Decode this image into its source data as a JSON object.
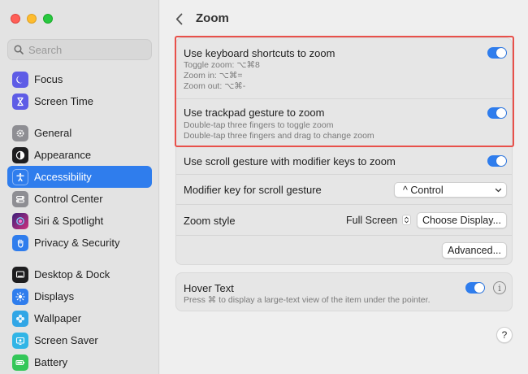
{
  "window": {
    "traffic_lights": [
      "close",
      "minimize",
      "maximize"
    ]
  },
  "sidebar": {
    "search": {
      "placeholder": "Search",
      "icon": "magnifying-glass-icon"
    },
    "items": [
      {
        "label": "Focus",
        "icon": "moon-icon",
        "color": "#5e5ce6"
      },
      {
        "label": "Screen Time",
        "icon": "hourglass-icon",
        "color": "#5e5ce6"
      },
      {
        "label": "General",
        "icon": "gear-icon",
        "color": "#8e8e93"
      },
      {
        "label": "Appearance",
        "icon": "appearance-icon",
        "color": "#1d1d1f"
      },
      {
        "label": "Accessibility",
        "icon": "accessibility-icon",
        "color": "#2f7ded",
        "selected": true
      },
      {
        "label": "Control Center",
        "icon": "control-center-icon",
        "color": "#8e8e93"
      },
      {
        "label": "Siri & Spotlight",
        "icon": "siri-icon",
        "color": "#7a3bd6"
      },
      {
        "label": "Privacy & Security",
        "icon": "hand-icon",
        "color": "#2f7ded"
      },
      {
        "label": "Desktop & Dock",
        "icon": "dock-icon",
        "color": "#1d1d1f"
      },
      {
        "label": "Displays",
        "icon": "sun-icon",
        "color": "#2f7ded"
      },
      {
        "label": "Wallpaper",
        "icon": "flower-icon",
        "color": "#31a6e6"
      },
      {
        "label": "Screen Saver",
        "icon": "screensaver-icon",
        "color": "#31b5e6"
      },
      {
        "label": "Battery",
        "icon": "battery-icon",
        "color": "#34c759"
      }
    ]
  },
  "header": {
    "title": "Zoom",
    "back_icon": "chevron-left-icon"
  },
  "group1": {
    "keyboard_shortcuts": {
      "title": "Use keyboard shortcuts to zoom",
      "toggle": true,
      "lines": [
        "Toggle zoom: ⌥⌘8",
        "Zoom in: ⌥⌘=",
        "Zoom out: ⌥⌘-"
      ]
    },
    "trackpad_gesture": {
      "title": "Use trackpad gesture to zoom",
      "toggle": true,
      "lines": [
        "Double-tap three fingers to toggle zoom",
        "Double-tap three fingers and drag to change zoom"
      ]
    },
    "scroll_gesture": {
      "title": "Use scroll gesture with modifier keys to zoom",
      "toggle": true
    },
    "modifier_key": {
      "title": "Modifier key for scroll gesture",
      "value": "^ Control"
    },
    "zoom_style": {
      "title": "Zoom style",
      "value": "Full Screen",
      "choose_button": "Choose Display..."
    },
    "advanced_button": "Advanced..."
  },
  "group2": {
    "hover_text": {
      "title": "Hover Text",
      "toggle": true,
      "description": "Press ⌘ to display a large-text view of the item under the pointer.",
      "info_icon": "i"
    }
  },
  "help_button": "?",
  "colors": {
    "accent": "#2f7ded",
    "highlight_border": "#e8504a"
  }
}
